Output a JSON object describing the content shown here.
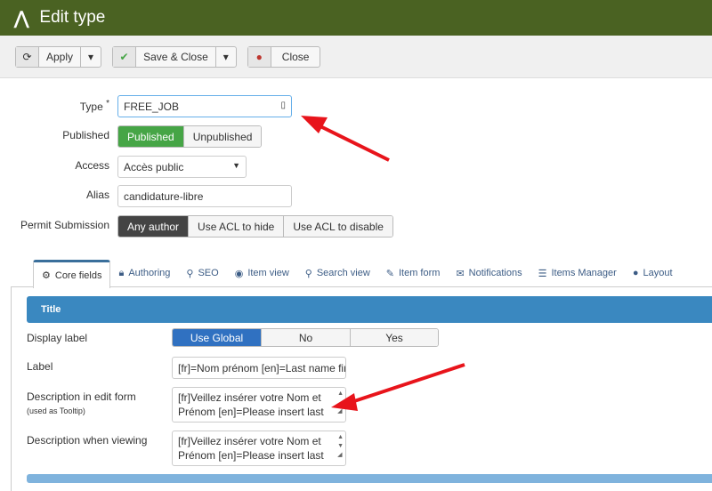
{
  "header": {
    "title": "Edit type",
    "logo_icon": "joomla-logo"
  },
  "toolbar": {
    "apply": "Apply",
    "save_close": "Save & Close",
    "close": "Close"
  },
  "form": {
    "type_label": "Type",
    "type_required": "*",
    "type_value": "FREE_JOB",
    "published_label": "Published",
    "published_opts": [
      "Published",
      "Unpublished"
    ],
    "access_label": "Access",
    "access_value": "Accès public",
    "alias_label": "Alias",
    "alias_value": "candidature-libre",
    "permit_label": "Permit Submission",
    "permit_opts": [
      "Any author",
      "Use ACL to hide",
      "Use ACL to disable"
    ]
  },
  "tabs": [
    "Core fields",
    "Authoring",
    "SEO",
    "Item view",
    "Search view",
    "Item form",
    "Notifications",
    "Items Manager",
    "Layout"
  ],
  "section": {
    "title": "Title",
    "display_label": "Display label",
    "display_opts": [
      "Use Global",
      "No",
      "Yes"
    ],
    "label_label": "Label",
    "label_value": "[fr]=Nom prénom [en]=Last name fir",
    "desc_edit_label": "Description in edit form",
    "desc_edit_hint": "(used as Tooltip)",
    "desc_edit_value": "[fr]Veillez insérer votre Nom et Prénom [en]=Please insert last name and first",
    "desc_view_label": "Description when viewing",
    "desc_view_value": "[fr]Veillez insérer votre Nom et Prénom [en]=Please insert last name and first"
  },
  "colors": {
    "header": "#4a6222",
    "published": "#46a546",
    "dark": "#444444",
    "blue": "#3a88c0",
    "active": "#3071c1",
    "arrow": "#e8141b"
  }
}
